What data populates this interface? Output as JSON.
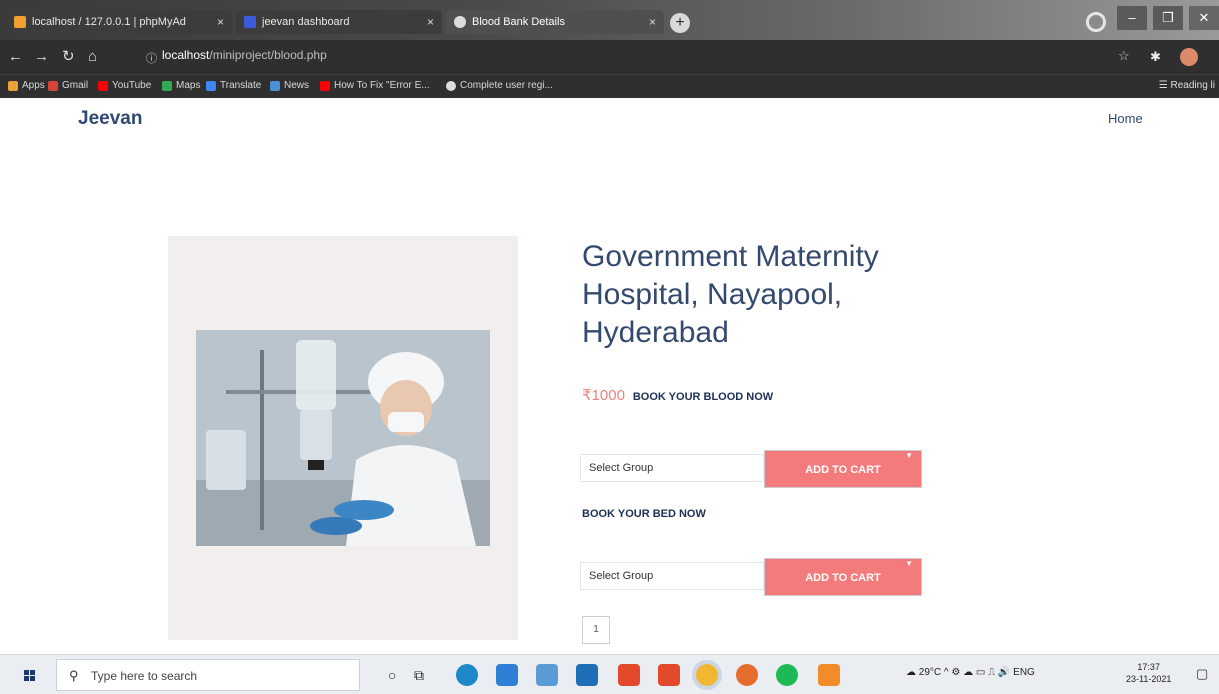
{
  "browser": {
    "tabs": [
      {
        "label": "localhost / 127.0.0.1 | phpMyAd"
      },
      {
        "label": "jeevan dashboard"
      },
      {
        "label": "Blood Bank Details"
      }
    ],
    "url_host": "localhost",
    "url_path": "/miniproject/blood.php",
    "bookmarks": [
      {
        "label": "Apps"
      },
      {
        "label": "Gmail"
      },
      {
        "label": "YouTube"
      },
      {
        "label": "Maps"
      },
      {
        "label": "Translate"
      },
      {
        "label": "News"
      },
      {
        "label": "How To Fix \"Error E..."
      },
      {
        "label": "Complete user regi..."
      }
    ],
    "reading_list": "Reading li"
  },
  "site": {
    "brand": "Jeevan",
    "nav_home": "Home"
  },
  "hospital": {
    "name": "Government Maternity Hospital, Nayapool, Hyderabad",
    "price": "₹1000",
    "book_blood_label": "BOOK YOUR BLOOD NOW",
    "blood_select_value": "Select Group",
    "blood_add_to_cart": "ADD TO CART",
    "book_bed_label": "BOOK YOUR BED NOW",
    "bed_select_value": "Select Group",
    "bed_add_to_cart": "ADD TO CART",
    "page_number": "1"
  },
  "taskbar": {
    "search_placeholder": "Type here to search",
    "weather": "29°C",
    "language": "ENG",
    "time": "17:37",
    "date": "23-11-2021"
  }
}
